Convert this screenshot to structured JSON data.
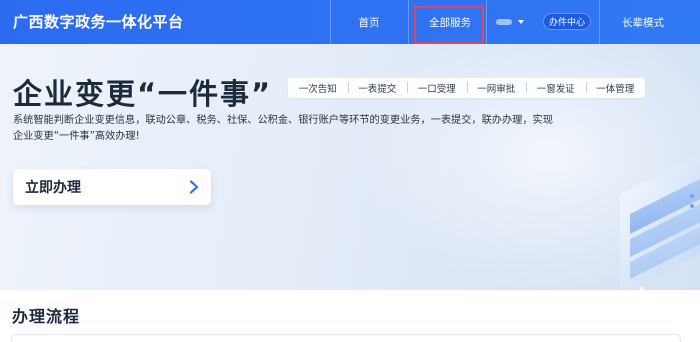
{
  "header": {
    "brand": "广西数字政务一体化平台",
    "nav": {
      "home": "首页",
      "all_services": "全部服务",
      "office_center": "办件中心",
      "elder_mode": "长辈模式"
    }
  },
  "hero": {
    "title": "企业变更“一件事”",
    "tags": [
      "一次告知",
      "一表提交",
      "一口受理",
      "一网审批",
      "一窗发证",
      "一体管理"
    ],
    "description_lines": [
      "系统智能判断企业变更信息，联动公章、税务、社保、公积金、银行账户等环节的变更业务，一表提交，联办办理，实现",
      "企业变更“一件事”高效办理!"
    ],
    "cta_label": "立即办理"
  },
  "process": {
    "title": "办理流程"
  },
  "colors": {
    "nav_bg": "#2f72f3",
    "badge_bg": "#1c5ae0",
    "highlight_border": "#e0475c",
    "cta_arrow": "#2f6fe8"
  },
  "icons": {
    "user_menu": "chevron-down-icon",
    "cta_arrow": "chevron-right-icon"
  }
}
